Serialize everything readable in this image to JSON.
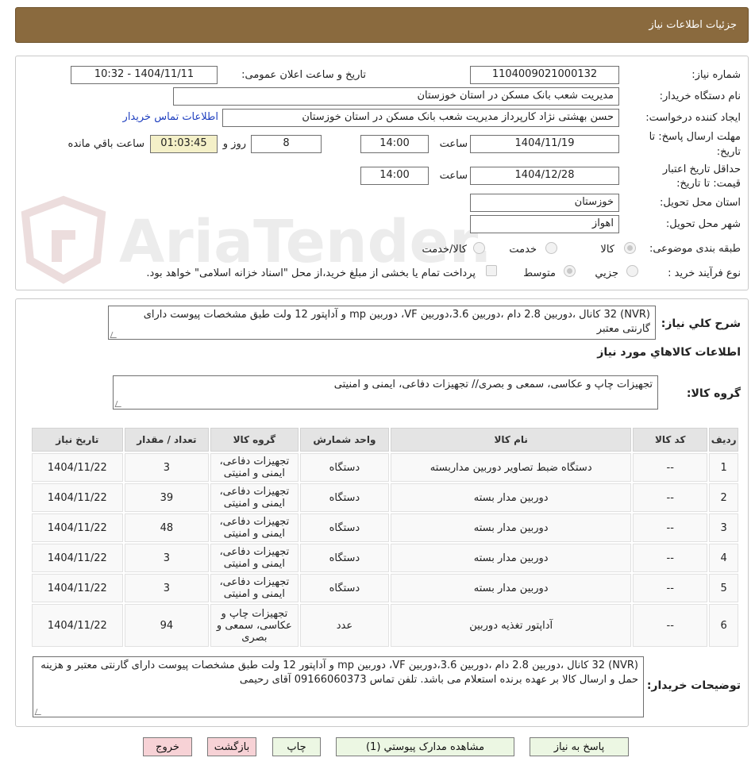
{
  "header": {
    "title": "جزئیات اطلاعات نیاز"
  },
  "fields": {
    "need_number_label": "شماره نیاز:",
    "need_number": "1104009021000132",
    "announce_label": "تاریخ و ساعت اعلان عمومی:",
    "announce_value": "1404/11/11 - 10:32",
    "buyer_org_label": "نام دستگاه خریدار:",
    "buyer_org": "مدیریت شعب بانک مسکن در استان خوزستان",
    "creator_label": "ایجاد کننده درخواست:",
    "creator": "حسن بهشتی نژاد کارپرداز مدیریت شعب بانک مسکن در استان خوزستان",
    "contact_link": "اطلاعات تماس خریدار",
    "deadline_label_1": "مهلت ارسال پاسخ: تا",
    "deadline_label_2": "تاریخ:",
    "deadline_date": "1404/11/19",
    "time_label": "ساعت",
    "deadline_time": "14:00",
    "days": "8",
    "days_label": "روز و",
    "remaining": "01:03:45",
    "remaining_label": "ساعت باقي مانده",
    "validity_label_1": "حداقل تاریخ اعتبار",
    "validity_label_2": "قیمت: تا تاریخ:",
    "validity_date": "1404/12/28",
    "validity_time": "14:00",
    "province_label": "استان محل تحویل:",
    "province": "خوزستان",
    "city_label": "شهر محل تحویل:",
    "city": "اهواز",
    "category_label": "طبقه بندی موضوعی:",
    "category_options": [
      "کالا",
      "خدمت",
      "کالا/خدمت"
    ],
    "category_selected": "کالا",
    "process_label": "نوع فرآیند خرید :",
    "process_options": [
      "جزيي",
      "متوسط"
    ],
    "process_selected": "متوسط",
    "treasury_note": "پرداخت تمام یا بخشی از مبلغ خرید،از محل \"اسناد خزانه اسلامی\" خواهد بود."
  },
  "summary": {
    "label": "شرح کلي نياز:",
    "text": "(NVR) 32 کانال ،دوربین 2.8 دام ،دوربین 3.6،دوربین VF، دوربین mp و آداپتور 12 ولت طبق مشخصات پیوست دارای گارنتی معتبر",
    "goods_title": "اطلاعات کالاهاي مورد نياز",
    "group_label": "گروه کالا:",
    "group_text": "تجهیزات چاپ و عکاسی، سمعی و بصری// تجهیزات دفاعی، ایمنی و امنیتی"
  },
  "table": {
    "headers": [
      "رديف",
      "کد کالا",
      "نام کالا",
      "واحد شمارش",
      "گروه کالا",
      "تعداد / مقدار",
      "تاريخ نياز"
    ],
    "rows": [
      [
        "1",
        "--",
        "دستگاه ضبط تصاویر دوربین مداربسته",
        "دستگاه",
        "تجهیزات دفاعی، ایمنی و امنیتی",
        "3",
        "1404/11/22"
      ],
      [
        "2",
        "--",
        "دوربین مدار بسته",
        "دستگاه",
        "تجهیزات دفاعی، ایمنی و امنیتی",
        "39",
        "1404/11/22"
      ],
      [
        "3",
        "--",
        "دوربین مدار بسته",
        "دستگاه",
        "تجهیزات دفاعی، ایمنی و امنیتی",
        "48",
        "1404/11/22"
      ],
      [
        "4",
        "--",
        "دوربین مدار بسته",
        "دستگاه",
        "تجهیزات دفاعی، ایمنی و امنیتی",
        "3",
        "1404/11/22"
      ],
      [
        "5",
        "--",
        "دوربین مدار بسته",
        "دستگاه",
        "تجهیزات دفاعی، ایمنی و امنیتی",
        "3",
        "1404/11/22"
      ],
      [
        "6",
        "--",
        "آداپتور تغذیه دوربین",
        "عدد",
        "تجهیزات چاپ و عکاسی، سمعی و بصری",
        "94",
        "1404/11/22"
      ]
    ]
  },
  "buyer_notes": {
    "label": "توضیحات خریدار:",
    "text": "(NVR) 32 کانال ،دوربین 2.8 دام ،دوربین 3.6،دوربین VF، دوربین mp و آداپتور 12 ولت طبق مشخصات پیوست دارای گارنتی معتبر و هزینه حمل و ارسال کالا بر عهده برنده استعلام می باشد. تلفن تماس 09166060373 آقای رحیمی"
  },
  "buttons": {
    "reply": "پاسخ به نیاز",
    "attachments": "مشاهده مدارک پیوستي (1)",
    "print": "چاپ",
    "back": "بازگشت",
    "exit": "خروج"
  },
  "watermark": {
    "text": "AriaTender.neT"
  },
  "colors": {
    "header_bg": "#8a6a3e",
    "link": "#1f3fbf",
    "green_button": "#ecf7e3",
    "pink_button": "#f7d2d6",
    "timer_bg": "#f4f0c8"
  }
}
